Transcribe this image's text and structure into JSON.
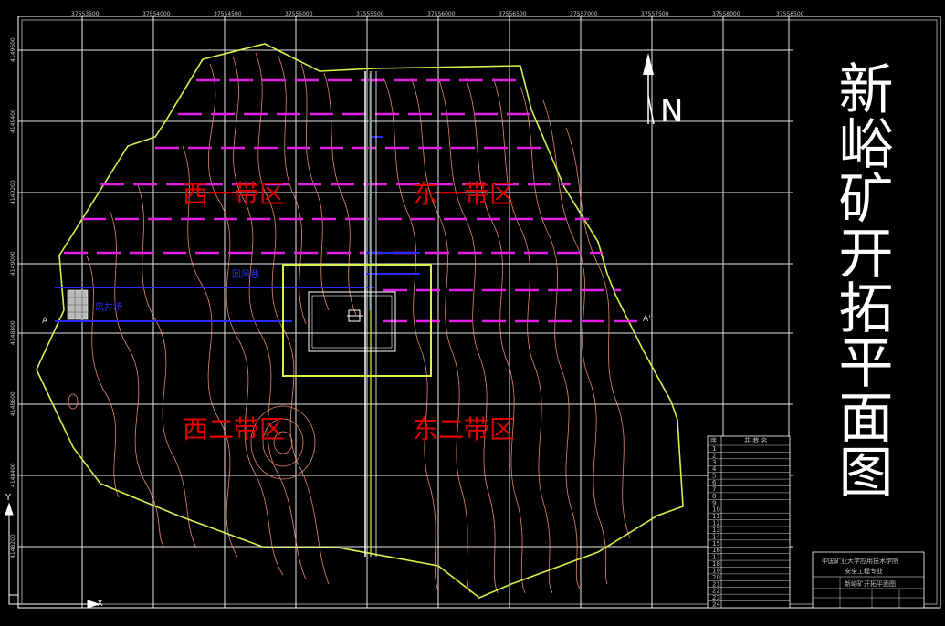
{
  "title": "新峪矿开拓平面图",
  "north_label": "N",
  "zones": {
    "west1": "西一带区",
    "east1": "东一带区",
    "west2": "西二带区",
    "east2": "东二带区"
  },
  "section_labels": {
    "left": "A",
    "right": "A'"
  },
  "small_labels": {
    "main": "回风巷",
    "air": "风井场"
  },
  "grid": {
    "x_labels": [
      "37553500",
      "37554000",
      "37554500",
      "37555000",
      "37555500",
      "37556000",
      "37556500",
      "37557000",
      "37557500",
      "37558000",
      "37558500"
    ],
    "y_labels": [
      "4149600",
      "4149400",
      "4149200",
      "4149000",
      "4148800",
      "4148600",
      "4148400",
      "4148200"
    ]
  },
  "legend_table": {
    "header": [
      "序",
      "井 巷 名"
    ],
    "rows": [
      "1",
      "2",
      "3",
      "4",
      "5",
      "6",
      "7",
      "8",
      "9",
      "10",
      "11",
      "12",
      "13",
      "14",
      "15",
      "16",
      "17",
      "18",
      "19",
      "20",
      "21",
      "22",
      "23",
      "24"
    ]
  },
  "title_block": {
    "org": "中国矿业大学应用技术学院",
    "major": "安全工程专业",
    "drawing_name": "新峪矿开拓平面图"
  },
  "colors": {
    "background": "#000000",
    "boundary": "#d8f04a",
    "contour": "#ff9a7a",
    "roadway": "#2a2aff",
    "dash": "#e020e0",
    "grid": "#ffffff",
    "zone_text": "#e00000"
  }
}
